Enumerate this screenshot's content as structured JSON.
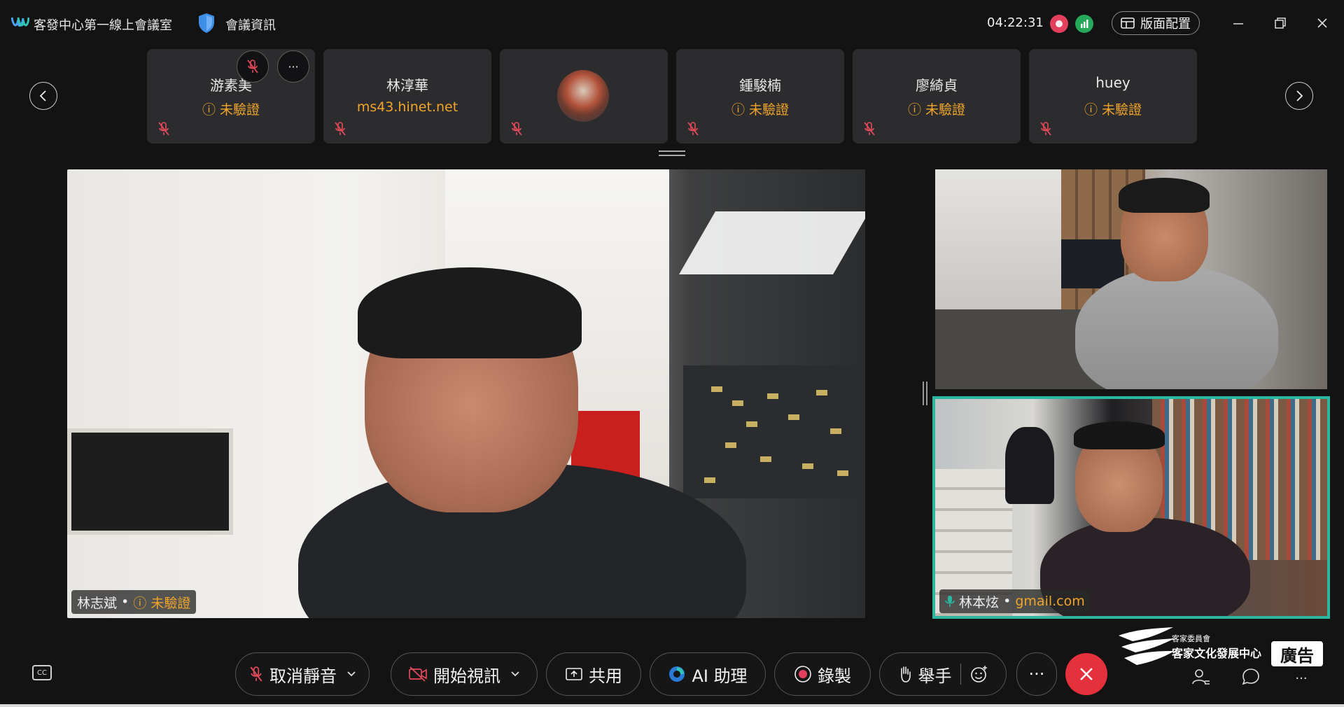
{
  "header": {
    "app_title": "客發中心第一線上會議室",
    "meeting_info": "會議資訊",
    "timer": "04:22:31",
    "layout_button": "版面配置",
    "colors": {
      "record": "#e3405e",
      "signal": "#25a85a"
    }
  },
  "participants": [
    {
      "name": "游素美",
      "status": "未驗證",
      "muted": true
    },
    {
      "name": "林淳華",
      "status": "ms43.hinet.net",
      "muted": true
    },
    {
      "name": "",
      "status": "",
      "muted": true,
      "avatar": "group-photo"
    },
    {
      "name": "鍾駿楠",
      "status": "未驗證",
      "muted": true
    },
    {
      "name": "廖綺貞",
      "status": "未驗證",
      "muted": true
    },
    {
      "name": "huey",
      "status": "未驗證",
      "muted": true
    }
  ],
  "card_overlay": {
    "more": "···"
  },
  "videos": {
    "main": {
      "name": "林志斌",
      "status": "未驗證"
    },
    "active": {
      "name": "林本炫",
      "status": "gmail.com",
      "border_color": "#2bb6a2"
    }
  },
  "toolbar": {
    "unmute": "取消靜音",
    "start_video": "開始視訊",
    "share": "共用",
    "ai": "AI 助理",
    "record": "錄製",
    "raise_hand": "舉手",
    "more": "···",
    "cc": "CC"
  },
  "ad": {
    "org_small": "客家委員會",
    "org_name": "客家文化發展中心",
    "badge": "廣告"
  }
}
